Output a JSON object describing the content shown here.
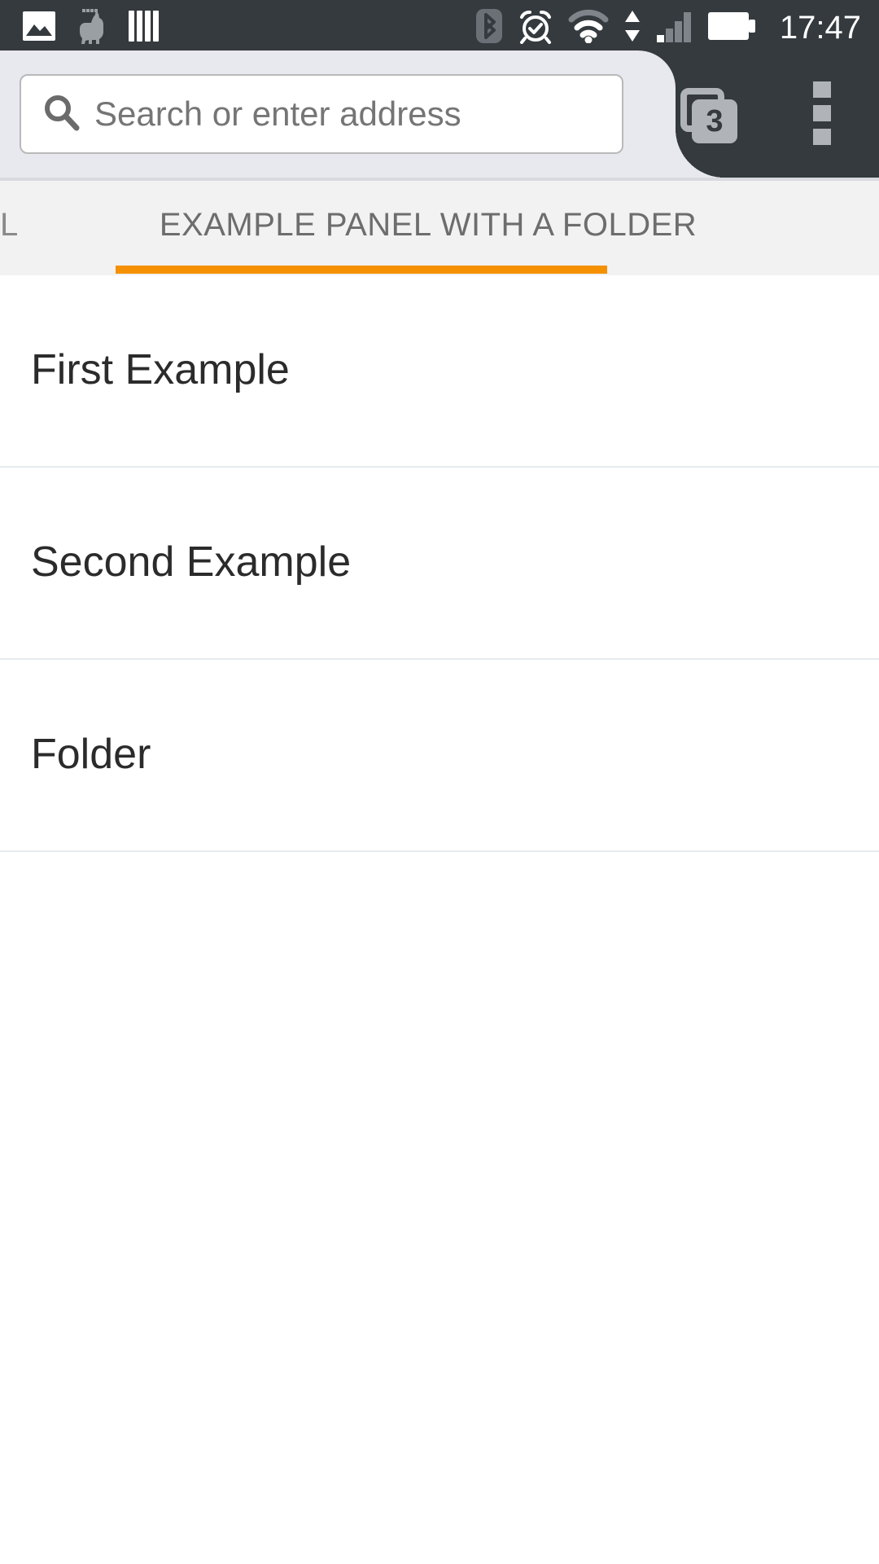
{
  "status_bar": {
    "left_icons": [
      {
        "name": "photo-icon",
        "label": "photo"
      },
      {
        "name": "llama-icon",
        "label": "llama"
      },
      {
        "name": "library-bars-icon",
        "label": "library"
      }
    ],
    "right_icons": [
      {
        "name": "bluetooth-icon",
        "label": "bluetooth",
        "state": "inactive"
      },
      {
        "name": "alarm-clock-icon",
        "label": "alarm"
      },
      {
        "name": "wifi-icon",
        "label": "wifi"
      },
      {
        "name": "data-transfer-arrows-icon",
        "label": "data transfer"
      },
      {
        "name": "cell-signal-icon",
        "label": "signal"
      },
      {
        "name": "battery-icon",
        "label": "battery"
      }
    ],
    "time": "17:47"
  },
  "toolbar": {
    "url_placeholder": "Search or enter address",
    "url_value": "",
    "tab_count": "3",
    "menu_label": "More options"
  },
  "panel_tabs": {
    "previous_tab_partial_label": "L",
    "active_tab_label": "EXAMPLE PANEL WITH A FOLDER",
    "accent_color": "#F59100"
  },
  "list": {
    "rows": [
      {
        "label": "First Example"
      },
      {
        "label": "Second Example"
      },
      {
        "label": "Folder"
      }
    ]
  },
  "colors": {
    "status_bar_bg": "#343A3E",
    "tab_shape_bg": "#E8E8EF",
    "tab_strip_bg": "#F2F2F2",
    "accent_orange": "#F59100",
    "divider": "#E6EBEE",
    "text_primary": "#2B2B2B",
    "text_muted": "#6D6D6D"
  }
}
